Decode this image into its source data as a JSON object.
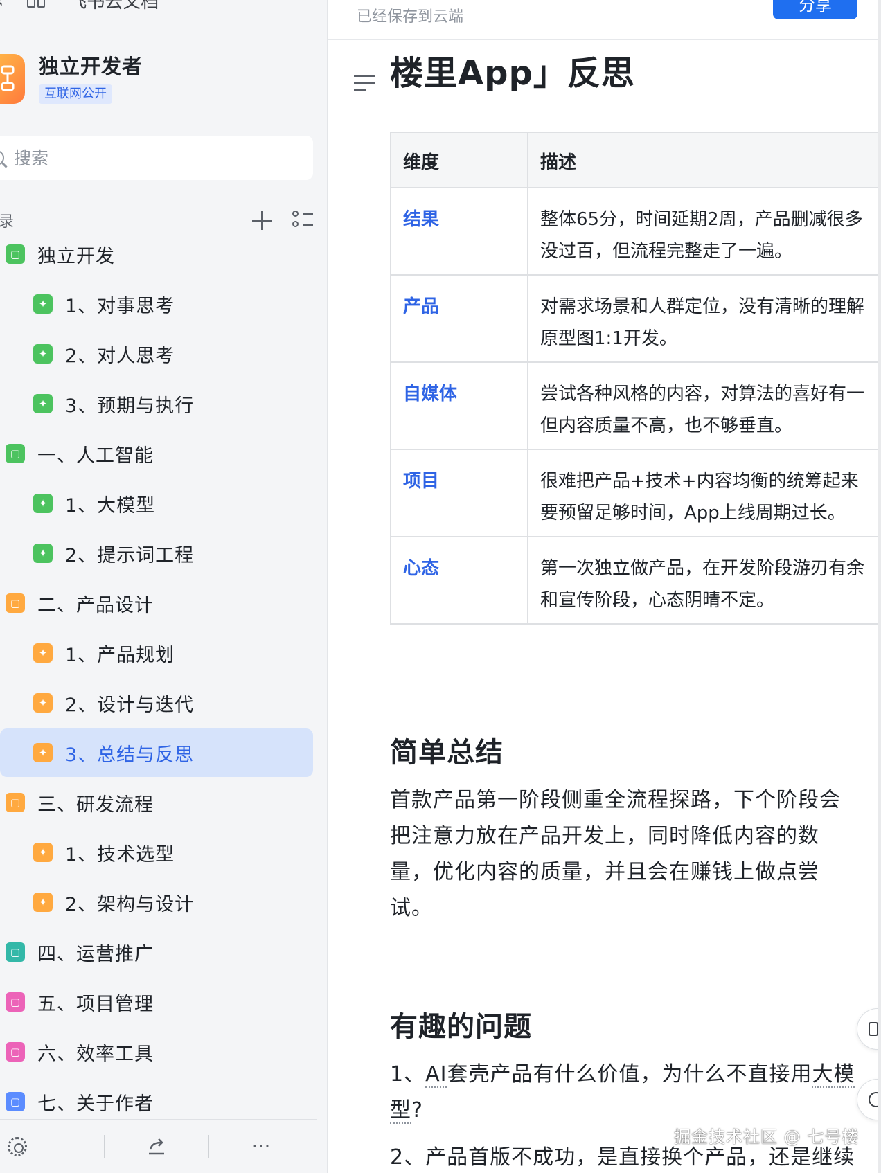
{
  "breadcrumb": {
    "label": "飞书云文档"
  },
  "space": {
    "name": "独立开发者",
    "badge": "互联网公开"
  },
  "search": {
    "placeholder": "搜索"
  },
  "catalog": {
    "title": "目录"
  },
  "tree": [
    {
      "label": "独立开发",
      "level": 1,
      "color": "green"
    },
    {
      "label": "1、对事思考",
      "level": 2,
      "color": "green"
    },
    {
      "label": "2、对人思考",
      "level": 2,
      "color": "green"
    },
    {
      "label": "3、预期与执行",
      "level": 2,
      "color": "green"
    },
    {
      "label": "一、人工智能",
      "level": 1,
      "color": "green"
    },
    {
      "label": "1、大模型",
      "level": 2,
      "color": "green"
    },
    {
      "label": "2、提示词工程",
      "level": 2,
      "color": "green"
    },
    {
      "label": "二、产品设计",
      "level": 1,
      "color": "orange"
    },
    {
      "label": "1、产品规划",
      "level": 2,
      "color": "orange"
    },
    {
      "label": "2、设计与迭代",
      "level": 2,
      "color": "orange"
    },
    {
      "label": "3、总结与反思",
      "level": 2,
      "color": "orange",
      "active": true
    },
    {
      "label": "三、研发流程",
      "level": 1,
      "color": "orange"
    },
    {
      "label": "1、技术选型",
      "level": 2,
      "color": "orange"
    },
    {
      "label": "2、架构与设计",
      "level": 2,
      "color": "orange"
    },
    {
      "label": "四、运营推广",
      "level": 1,
      "color": "teal"
    },
    {
      "label": "五、项目管理",
      "level": 1,
      "color": "pink"
    },
    {
      "label": "六、效率工具",
      "level": 1,
      "color": "pink"
    },
    {
      "label": "七、关于作者",
      "level": 1,
      "color": "blue"
    }
  ],
  "bottom": {
    "more": "···"
  },
  "topbar": {
    "saved": "已经保存到云端",
    "share": "分享"
  },
  "doc": {
    "title": "楼里App」反思",
    "table": {
      "headers": [
        "维度",
        "描述"
      ],
      "rows": [
        {
          "dim": "结果",
          "line1": "整体65分，时间延期2周，产品删减很多",
          "line2": "没过百，但流程完整走了一遍。"
        },
        {
          "dim": "产品",
          "line1": "对需求场景和人群定位，没有清晰的理解",
          "line2": "原型图1:1开发。"
        },
        {
          "dim": "自媒体",
          "line1": "尝试各种风格的内容，对算法的喜好有一",
          "line2": "但内容质量不高，也不够垂直。"
        },
        {
          "dim": "项目",
          "line1": "很难把产品+技术+内容均衡的统筹起来",
          "line2": "要预留足够时间，App上线周期过长。"
        },
        {
          "dim": "心态",
          "line1": "第一次独立做产品，在开发阶段游刃有余",
          "line2": "和宣传阶段，心态阴晴不定。"
        }
      ]
    },
    "summary_heading": "简单总结",
    "summary_lines": [
      "首款产品第一阶段侧重全流程探路，下个阶段会",
      "把注意力放在产品开发上，同时降低内容的数",
      "量，优化内容的质量，并且会在赚钱上做点尝",
      "试。"
    ],
    "questions_heading": "有趣的问题",
    "q1_a": "1、",
    "q1_ai": "AI",
    "q1_b": "套壳产品有什么价值，为什么不直接用",
    "q1_model": "大模",
    "q1_model2": "型",
    "q1_end": "?",
    "q2": "2、产品首版不成功，是直接换个产品，还是继续"
  },
  "watermark": "掘金技术社区 @ 七号楼"
}
